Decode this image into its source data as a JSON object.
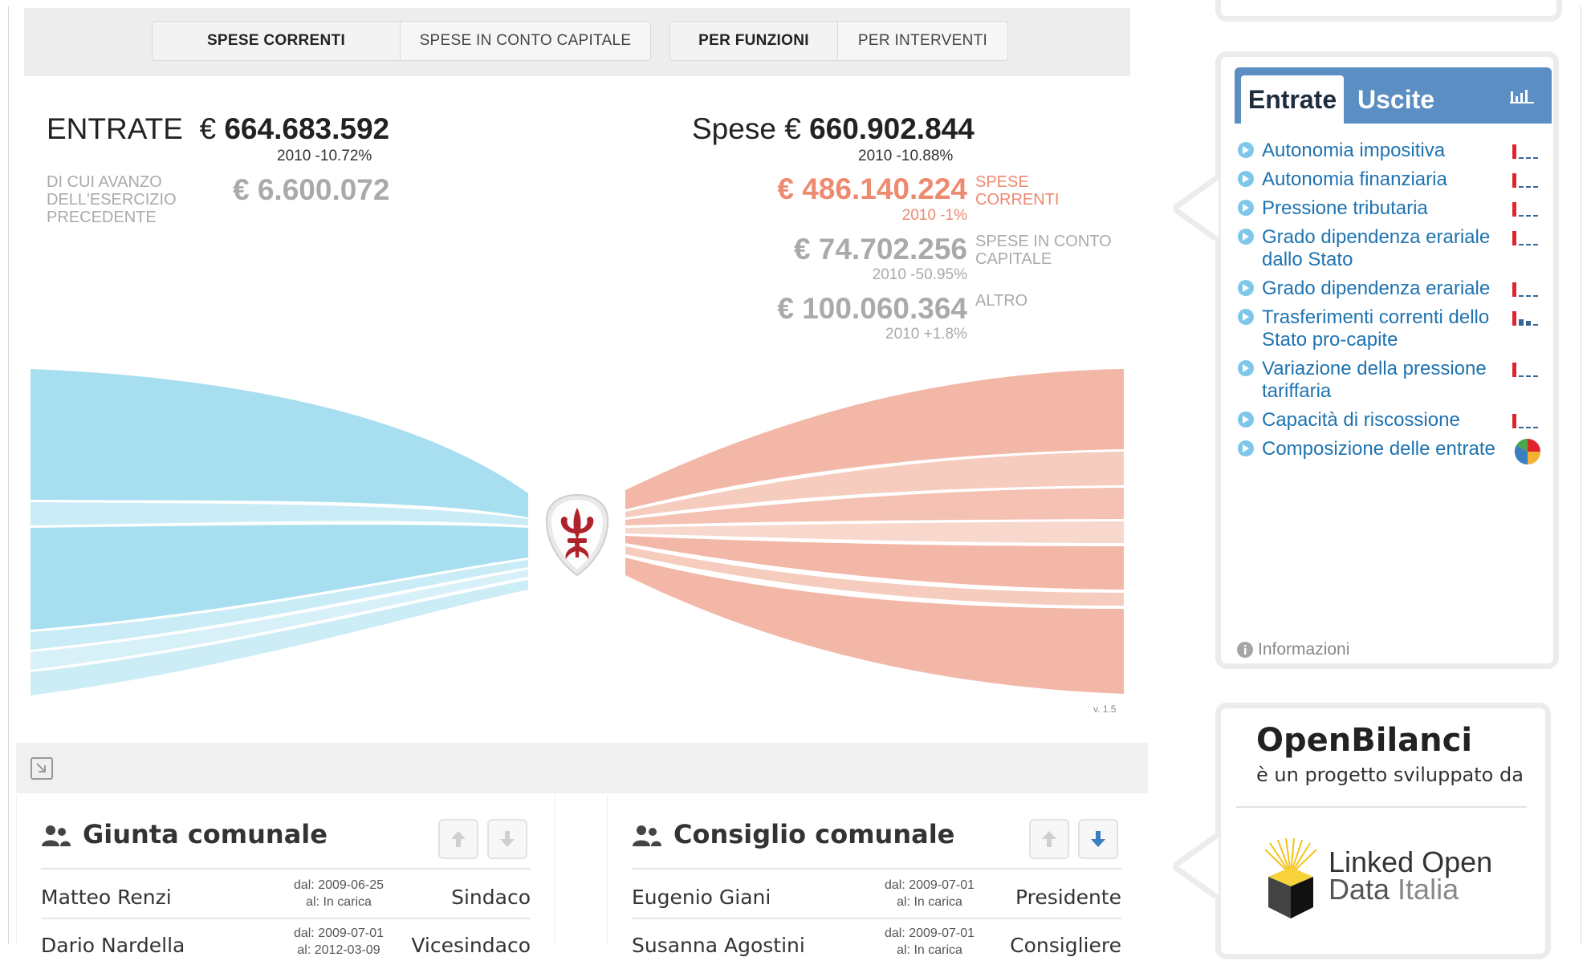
{
  "toolbar": {
    "group1": [
      "SPESE CORRENTI",
      "SPESE IN CONTO CAPITALE"
    ],
    "group2": [
      "PER FUNZIONI",
      "PER INTERVENTI"
    ]
  },
  "entrate": {
    "label": "ENTRATE",
    "currency": "€",
    "amount": "664.683.592",
    "compare": "2010 -10.72%",
    "avanzo_label": "DI CUI AVANZO DELL'ESERCIZIO PRECEDENTE",
    "avanzo_amount": "€ 6.600.072"
  },
  "spese": {
    "label": "Spese",
    "currency": "€",
    "amount": "660.902.844",
    "compare": "2010 -10.88%",
    "breakdown": [
      {
        "amount": "€ 486.140.224",
        "label": "SPESE CORRENTI",
        "compare": "2010 -1%"
      },
      {
        "amount": "€ 74.702.256",
        "label": "SPESE IN CONTO CAPITALE",
        "compare": "2010 -50.95%"
      },
      {
        "amount": "€ 100.060.364",
        "label": "ALTRO",
        "compare": "2010 +1.8%"
      }
    ]
  },
  "version": "v. 1.5",
  "indicators": {
    "tab_active": "Entrate",
    "tab_inactive": "Uscite",
    "items": [
      "Autonomia impositiva",
      "Autonomia finanziaria",
      "Pressione tributaria",
      "Grado dipendenza erariale dallo Stato",
      "Grado dipendenza erariale",
      "Trasferimenti correnti dello Stato pro-capite",
      "Variazione della pressione tariffaria",
      "Capacità di riscossione",
      "Composizione delle entrate"
    ],
    "info_label": "Informazioni"
  },
  "promo": {
    "brand_bold": "Open",
    "brand_rest": "Bilanci",
    "tagline": "è un progetto sviluppato da",
    "partner_line1": "Linked Open",
    "partner_line2a": "Data ",
    "partner_line2b": "Italia"
  },
  "giunta": {
    "title": "Giunta comunale",
    "members": [
      {
        "name": "Matteo Renzi",
        "from": "dal: 2009-06-25",
        "to": "al: In carica",
        "role": "Sindaco"
      },
      {
        "name": "Dario Nardella",
        "from": "dal: 2009-07-01",
        "to": "al: 2012-03-09",
        "role": "Vicesindaco"
      }
    ]
  },
  "consiglio": {
    "title": "Consiglio comunale",
    "members": [
      {
        "name": "Eugenio Giani",
        "from": "dal: 2009-07-01",
        "to": "al: In carica",
        "role": "Presidente"
      },
      {
        "name": "Susanna Agostini",
        "from": "dal: 2009-07-01",
        "to": "al: In carica",
        "role": "Consigliere"
      }
    ]
  },
  "colors": {
    "entrate_flow": "#a7dff0",
    "spese_flow": "#f2b7a6",
    "accent_blue": "#5b8ec2",
    "link_blue": "#1e73b0",
    "salmon": "#ee8a70"
  }
}
